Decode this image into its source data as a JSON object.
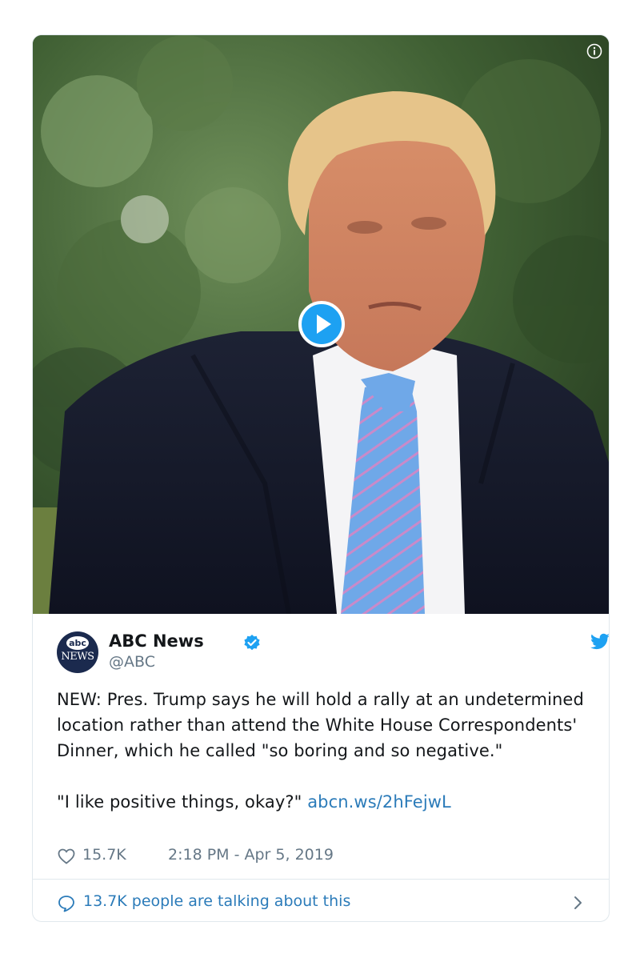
{
  "media": {
    "info_icon": "info-icon",
    "play_icon": "play-icon"
  },
  "author": {
    "name": "ABC News",
    "handle": "@ABC",
    "avatar_top": "abc",
    "avatar_bottom": "NEWS",
    "verified_icon": "verified-badge-icon"
  },
  "tweet": {
    "paragraph1": "NEW: Pres. Trump says he will hold a rally at an undetermined location rather than attend the White House Correspondents' Dinner, which he called \"so boring and so negative.\"",
    "paragraph2_text": "\"I like positive things, okay?\"",
    "link": "abcn.ws/2hFejwL"
  },
  "meta": {
    "likes": "15.7K",
    "timestamp": "2:18 PM - Apr 5, 2019"
  },
  "footer": {
    "talking": "13.7K people are talking about this"
  },
  "colors": {
    "link": "#2b7bb9",
    "twitter_blue": "#1da1f2",
    "secondary_text": "#657786",
    "border": "#e1e8ed"
  }
}
